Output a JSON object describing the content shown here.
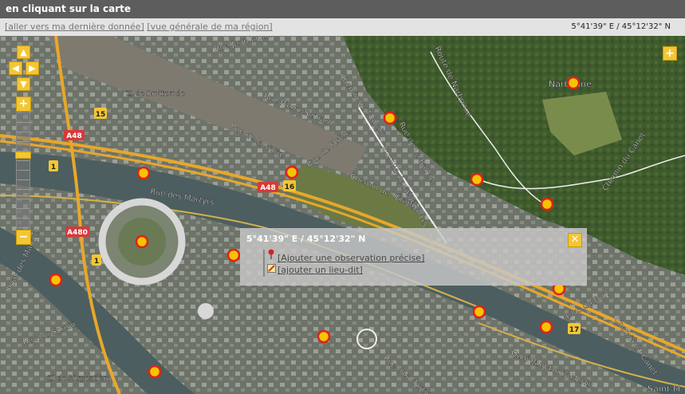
{
  "header": {
    "title": "en cliquant sur la carte"
  },
  "toolbar": {
    "link_last": "[aller vers ma dernière donnée]",
    "link_region": "[vue générale de ma région]",
    "coords": "5°41'39\" E / 45°12'32\" N"
  },
  "map": {
    "labels": [
      {
        "id": "rue-jean-moulin",
        "text": "Rue Jean Moulin"
      },
      {
        "id": "rue-pierre-semard",
        "text": "Rue Pierre Semard"
      },
      {
        "id": "chemin-du-maguis",
        "text": "Chemin du Maguis"
      },
      {
        "id": "route-de-narbonne",
        "text": "Route de Narbonne"
      },
      {
        "id": "narbonne",
        "text": "Narbonne"
      },
      {
        "id": "zi-brotterode",
        "text": "ZI de Brotterode"
      },
      {
        "id": "rue-de-la-carre",
        "text": "Rue de la Carre"
      },
      {
        "id": "rue-de-lisere",
        "text": "Rue de l'Isère"
      },
      {
        "id": "rue-de-la-balme",
        "text": "Rue de La Balme"
      },
      {
        "id": "avenue-general-leclerc",
        "text": "Avenue du Général Leclerc"
      },
      {
        "id": "chemin-de-letang",
        "text": "Chemin de l'Étang"
      },
      {
        "id": "chemin-du-canet",
        "text": "Chemin du Canet"
      },
      {
        "id": "rue-des-martyrs",
        "text": "Rue des Martyrs"
      },
      {
        "id": "pont-des-martyrs",
        "text": "Pont des Martyrs"
      },
      {
        "id": "rue-du-sornin",
        "text": "Rue du Sornin"
      },
      {
        "id": "zi-argentiere",
        "text": "ZI de l'Argentière"
      },
      {
        "id": "clos-du-don",
        "text": "Clos du Don"
      },
      {
        "id": "chemin-du-canet-2",
        "text": "Chemin du Canet"
      },
      {
        "id": "quai-paul-louis-merlin",
        "text": "Quai Paul-Louis Merlin"
      },
      {
        "id": "saint-m",
        "text": "Saint-M"
      },
      {
        "id": "rue-des-martyrs-2",
        "text": "Rue des Martyrs"
      }
    ],
    "shields": [
      {
        "id": "a48-left",
        "text": "A48"
      },
      {
        "id": "a48-mid",
        "text": "A48"
      },
      {
        "id": "a480",
        "text": "A480"
      },
      {
        "id": "r15",
        "text": "15"
      },
      {
        "id": "r16",
        "text": "16"
      },
      {
        "id": "r1a",
        "text": "1"
      },
      {
        "id": "r1b",
        "text": "1"
      },
      {
        "id": "r17",
        "text": "17"
      }
    ]
  },
  "controls": {
    "up": "▲",
    "left": "◀",
    "right": "▶",
    "down": "▼",
    "zoom_in": "+",
    "zoom_out": "−",
    "expand": "+"
  },
  "popup": {
    "title": "5°41'39\" E / 45°12'32\" N",
    "link_observation": "[Ajouter une observation précise]",
    "link_lieudit": "[ajouter un lieu-dit]",
    "close": "✕"
  },
  "colors": {
    "marker_fill": "#f5c400",
    "marker_ring": "#e0201c",
    "control": "#f3c634"
  }
}
